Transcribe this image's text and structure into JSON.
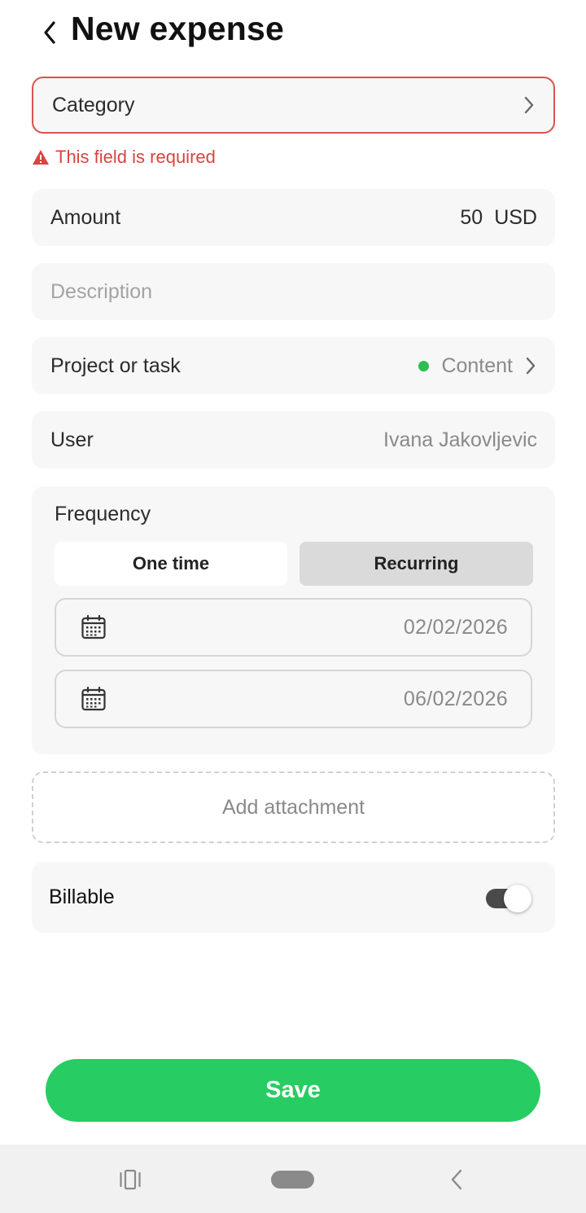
{
  "header": {
    "title": "New expense"
  },
  "category": {
    "label": "Category",
    "error": "This field is required"
  },
  "amount": {
    "label": "Amount",
    "value": "50",
    "currency": "USD"
  },
  "description": {
    "placeholder": "Description"
  },
  "project": {
    "label": "Project or task",
    "value": "Content",
    "dot_color": "#2dbe4e"
  },
  "user": {
    "label": "User",
    "value": "Ivana Jakovljevic"
  },
  "frequency": {
    "label": "Frequency",
    "options": [
      "One time",
      "Recurring"
    ],
    "selected": "Recurring",
    "start_date": "02/02/2026",
    "end_date": "06/02/2026"
  },
  "attachment": {
    "label": "Add attachment"
  },
  "billable": {
    "label": "Billable",
    "enabled": true
  },
  "save": {
    "label": "Save"
  },
  "colors": {
    "accent": "#27cd62",
    "error": "#d9443f"
  },
  "icons": [
    "back-chevron-icon",
    "chevron-right-icon",
    "warning-icon",
    "calendar-icon",
    "recent-apps-icon",
    "home-pill-icon",
    "nav-back-icon"
  ]
}
